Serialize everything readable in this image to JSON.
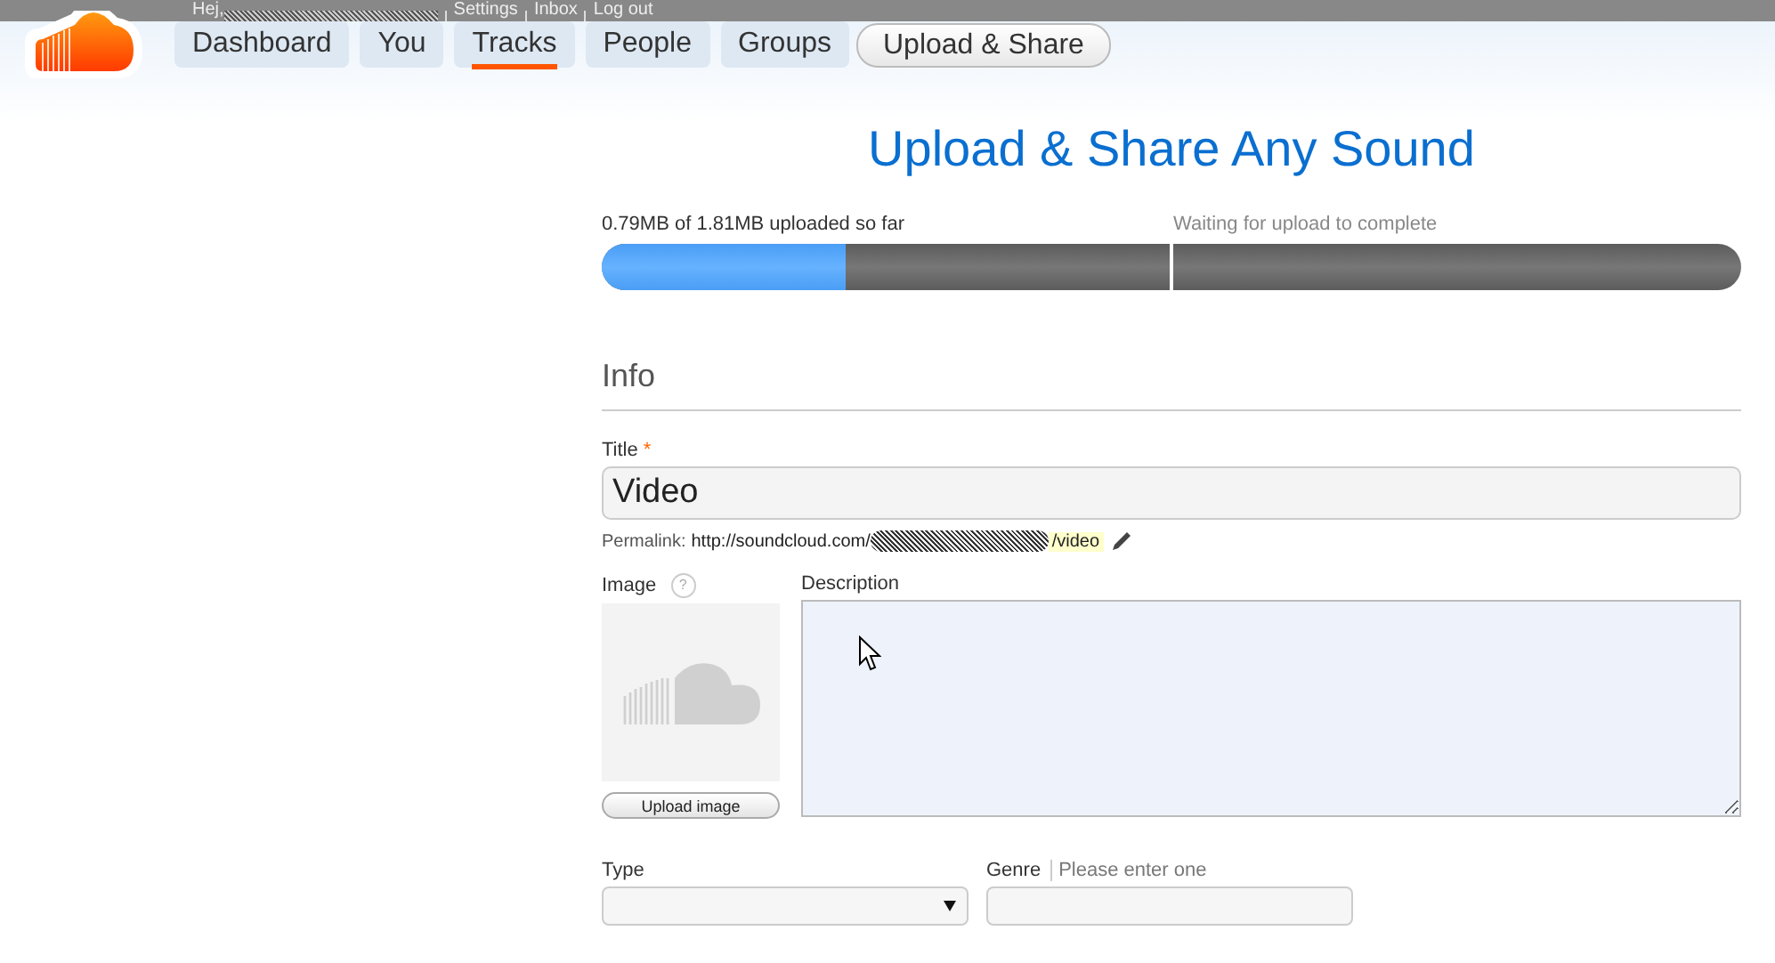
{
  "top_bar": {
    "greeting": "Hej,",
    "links": [
      "Settings",
      "Inbox",
      "Log out"
    ]
  },
  "nav": {
    "tabs": [
      {
        "label": "Dashboard",
        "selected": false
      },
      {
        "label": "You",
        "selected": false
      },
      {
        "label": "Tracks",
        "selected": true
      },
      {
        "label": "People",
        "selected": false
      },
      {
        "label": "Groups",
        "selected": false
      }
    ],
    "upload_button": "Upload & Share"
  },
  "heading": "Upload & Share Any Sound",
  "progress": [
    {
      "label": "0.79MB of 1.81MB uploaded so far",
      "level": 0.43,
      "active": true
    },
    {
      "label": "Waiting for upload to complete",
      "active": false
    }
  ],
  "form": {
    "section": "Info",
    "title_label": "Title",
    "required_mark": "*",
    "title_value": "Video",
    "permalink_label": "Permalink:",
    "permalink_base": "http://soundcloud.com/",
    "permalink_slug": "/video",
    "image_label": "Image",
    "help_mark": "?",
    "upload_image_button": "Upload image",
    "description_label": "Description",
    "type_label": "Type",
    "genre_label": "Genre",
    "genre_hint": "Please enter one"
  }
}
